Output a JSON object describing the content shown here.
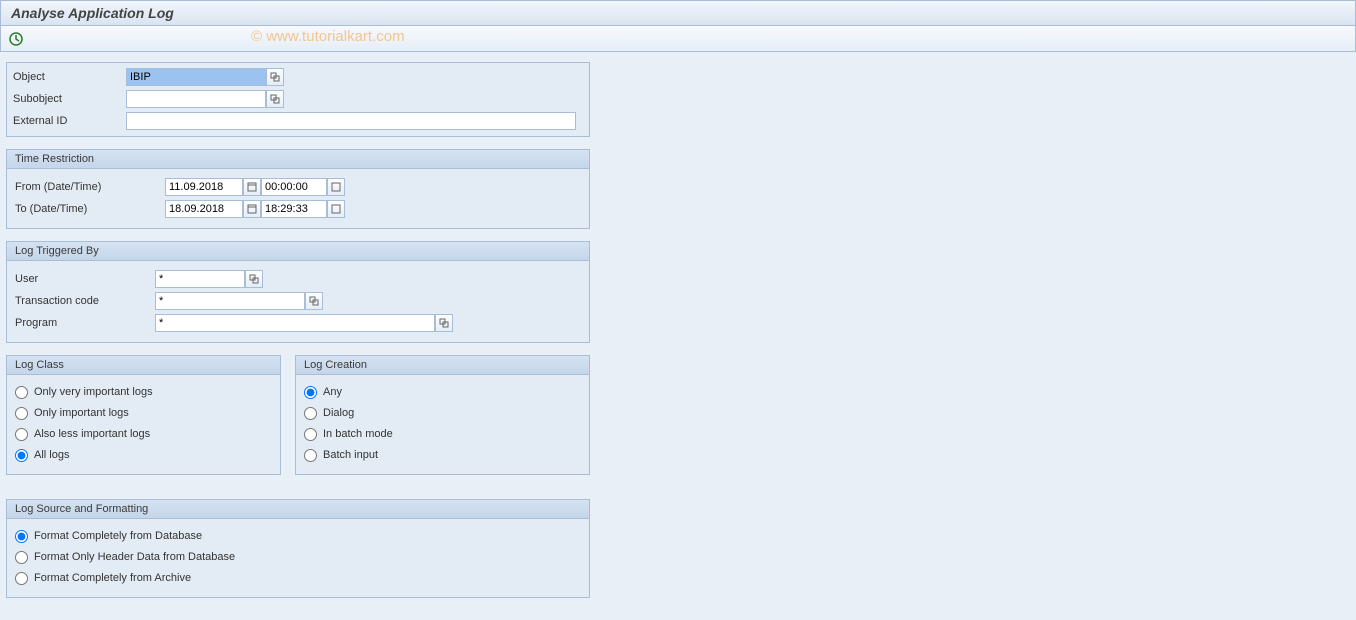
{
  "page": {
    "title": "Analyse Application Log"
  },
  "watermark": "© www.tutorialkart.com",
  "basic": {
    "object_label": "Object",
    "object_value": "IBIP",
    "subobject_label": "Subobject",
    "subobject_value": "",
    "extid_label": "External ID",
    "extid_value": ""
  },
  "time": {
    "title": "Time Restriction",
    "from_label": "From (Date/Time)",
    "from_date": "11.09.2018",
    "from_time": "00:00:00",
    "to_label": "To (Date/Time)",
    "to_date": "18.09.2018",
    "to_time": "18:29:33"
  },
  "triggered": {
    "title": "Log Triggered By",
    "user_label": "User",
    "user_value": "*",
    "tcode_label": "Transaction code",
    "tcode_value": "*",
    "program_label": "Program",
    "program_value": "*"
  },
  "logclass": {
    "title": "Log Class",
    "opt1": "Only very important logs",
    "opt2": "Only important logs",
    "opt3": "Also less important logs",
    "opt4": "All logs"
  },
  "logcreation": {
    "title": "Log Creation",
    "opt1": "Any",
    "opt2": "Dialog",
    "opt3": "In batch mode",
    "opt4": "Batch input"
  },
  "logsource": {
    "title": "Log Source and Formatting",
    "opt1": "Format Completely from Database",
    "opt2": "Format Only Header Data from Database",
    "opt3": "Format Completely from Archive"
  }
}
